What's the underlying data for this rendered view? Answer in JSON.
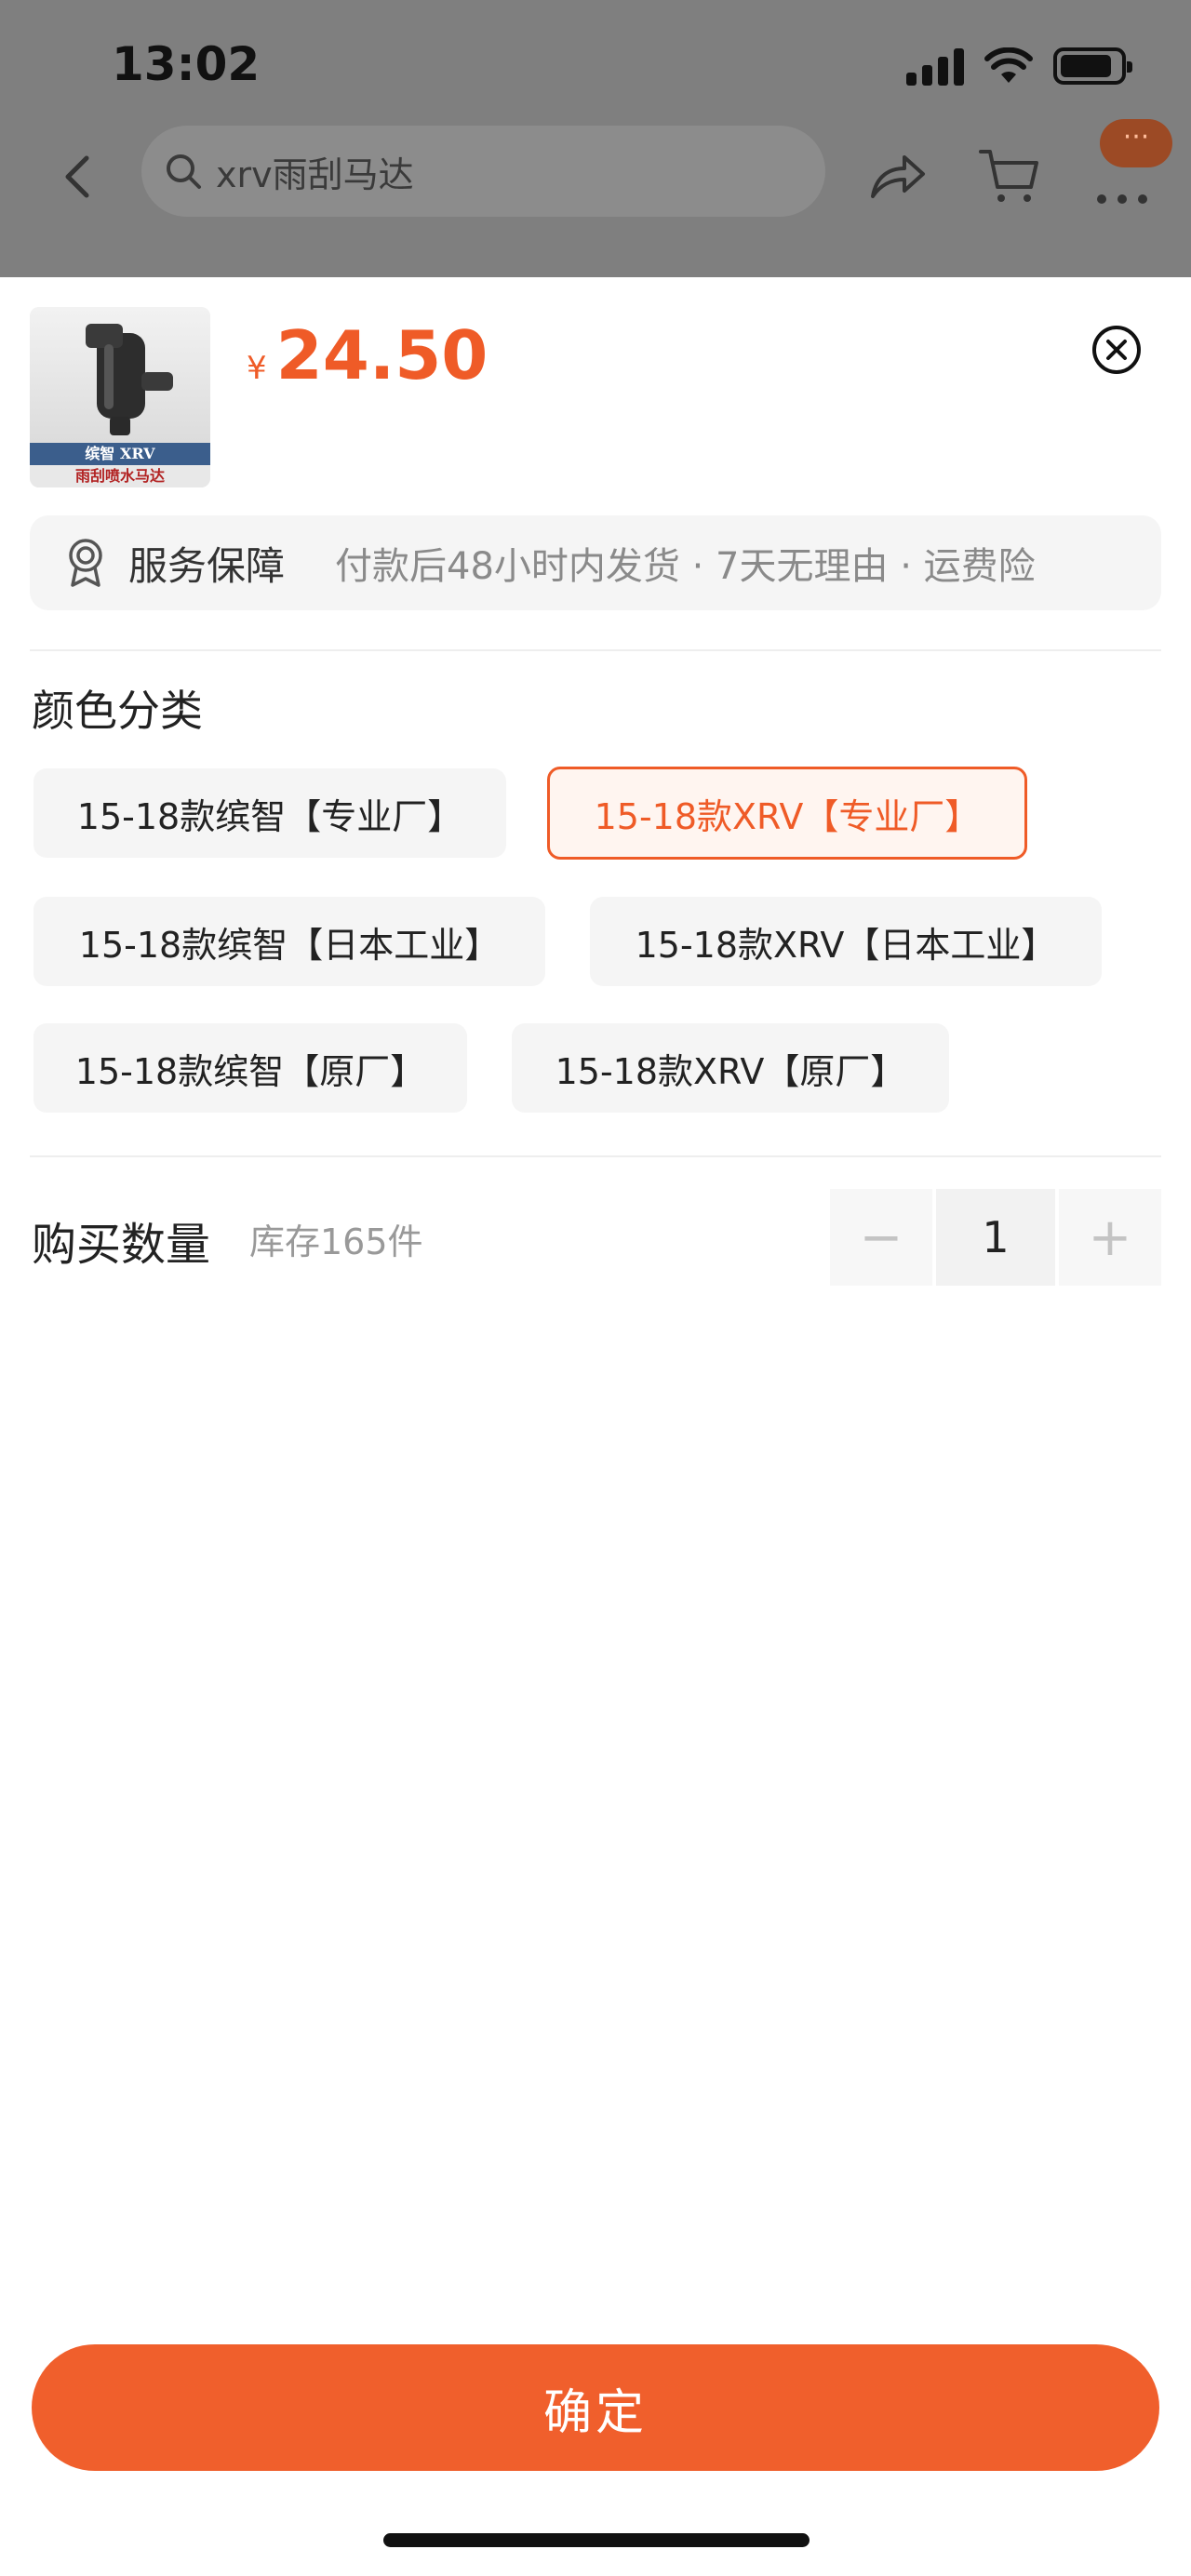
{
  "status_bar": {
    "time": "13:02"
  },
  "nav": {
    "search_text": "xrv雨刮马达",
    "badge_text": "···"
  },
  "product": {
    "image_band_top": "缤智 XRV",
    "image_band_bottom": "雨刮喷水马达",
    "currency_symbol": "¥",
    "price": "24.50"
  },
  "service": {
    "label": "服务保障",
    "description": "付款后48小时内发货 · 7天无理由 · 运费险"
  },
  "color_section": {
    "title": "颜色分类",
    "options": [
      {
        "label": "15-18款缤智【专业厂】",
        "selected": false
      },
      {
        "label": "15-18款XRV【专业厂】",
        "selected": true
      },
      {
        "label": "15-18款缤智【日本工业】",
        "selected": false
      },
      {
        "label": "15-18款XRV【日本工业】",
        "selected": false
      },
      {
        "label": "15-18款缤智【原厂】",
        "selected": false
      },
      {
        "label": "15-18款XRV【原厂】",
        "selected": false
      }
    ]
  },
  "quantity": {
    "label": "购买数量",
    "stock": "库存165件",
    "minus": "−",
    "value": "1",
    "plus": "+"
  },
  "confirm_label": "确定",
  "colors": {
    "accent": "#ef5b27",
    "button": "#f05f2c"
  }
}
